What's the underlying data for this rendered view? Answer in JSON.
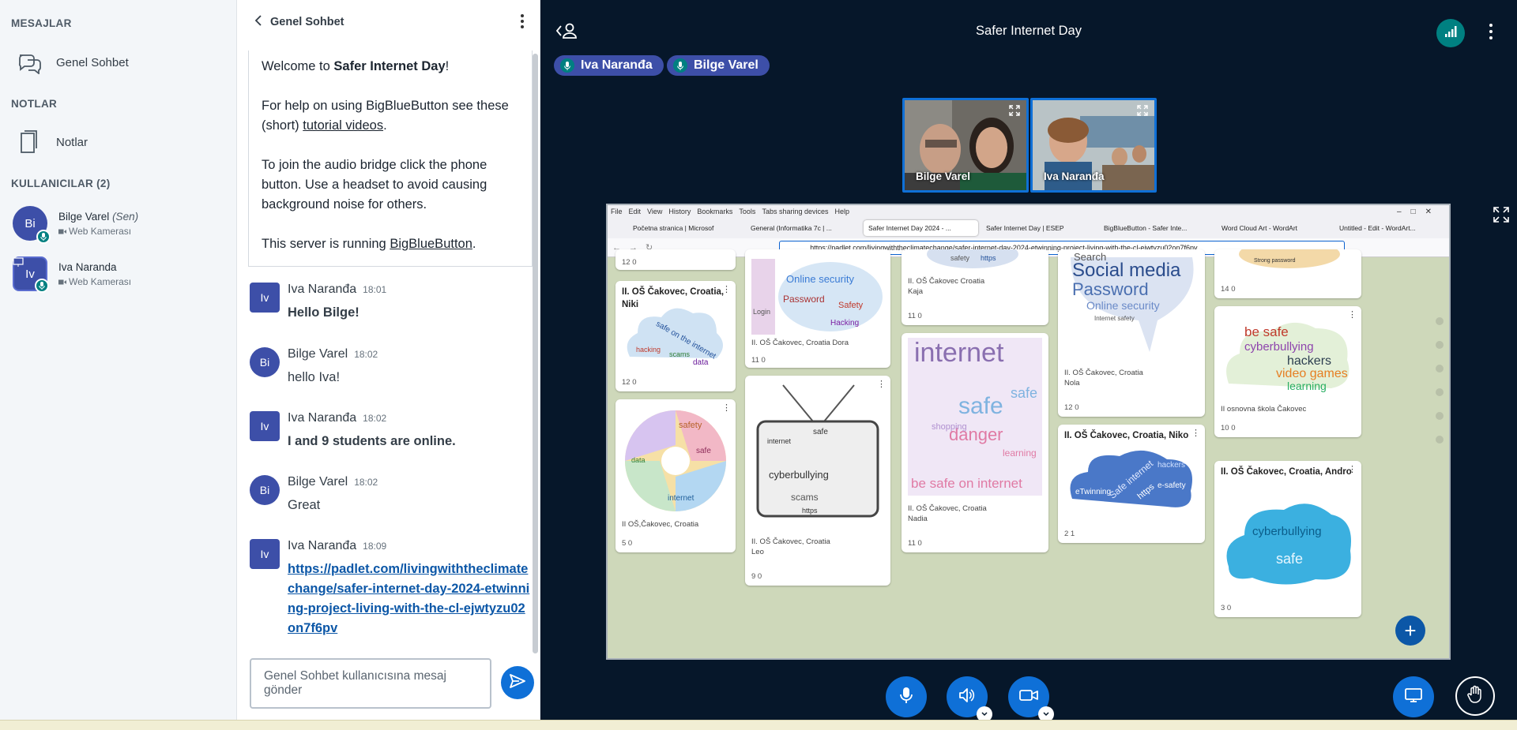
{
  "userlist": {
    "messages_title": "MESAJLAR",
    "public_chat": "Genel Sohbet",
    "notes_title": "NOTLAR",
    "notes_label": "Notlar",
    "users_title": "KULLANICILAR (2)",
    "users": [
      {
        "initials": "Bi",
        "name": "Bilge Varel",
        "you": "(Sen)",
        "sub": "Web Kamerası"
      },
      {
        "initials": "Iv",
        "name": "Iva Naranda",
        "you": "",
        "sub": "Web Kamerası"
      }
    ]
  },
  "chat": {
    "title": "Genel Sohbet",
    "welcome": {
      "line1_pre": "Welcome to ",
      "line1_bold": "Safer Internet Day",
      "line1_post": "!",
      "line2_pre": "For help on using BigBlueButton see these (short) ",
      "line2_link": "tutorial videos",
      "line2_post": ".",
      "line3": "To join the audio bridge click the phone button. Use a headset to avoid causing background noise for others.",
      "line4_pre": "This server is running ",
      "line4_link": "BigBlueButton",
      "line4_post": "."
    },
    "messages": [
      {
        "initials": "Iv",
        "name": "Iva Naranđa",
        "time": "18:01",
        "text": "Hello Bilge!"
      },
      {
        "initials": "Bi",
        "name": "Bilge Varel",
        "time": "18:02",
        "text": "hello Iva!"
      },
      {
        "initials": "Iv",
        "name": "Iva Naranđa",
        "time": "18:02",
        "text": "I and 9 students are online."
      },
      {
        "initials": "Bi",
        "name": "Bilge Varel",
        "time": "18:02",
        "text": "Great"
      },
      {
        "initials": "Iv",
        "name": "Iva Naranđa",
        "time": "18:09",
        "text": "https://padlet.com/livingwiththeclimatechange/safer-internet-day-2024-etwinning-project-living-with-the-cl-ejwtyzu02on7f6pv"
      }
    ],
    "composer_placeholder": "Genel Sohbet kullanıcısına mesaj gönder"
  },
  "main": {
    "title": "Safer Internet Day",
    "talkers": [
      "Iva Naranđa",
      "Bilge Varel"
    ],
    "cams": [
      "Bilge Varel",
      "Iva Naranđa"
    ]
  },
  "browser": {
    "menu": [
      "File",
      "Edit",
      "View",
      "History",
      "Bookmarks",
      "Tools",
      "Tabs sharing devices",
      "Help"
    ],
    "tabs": [
      "Početna stranica | Microsof",
      "General (Informatika 7c | ...",
      "Safer Internet Day 2024 - ...",
      "Safer Internet Day | ESEP",
      "BigBlueButton - Safer Inte...",
      "Word Cloud Art - WordArt",
      "Untitled - Edit - WordArt..."
    ],
    "url": "https://padlet.com/livingwiththeclimatechange/safer-internet-day-2024-etwinning-project-living-with-the-cl-ejwtyzu02on7f6pv"
  },
  "padlet": {
    "cards": [
      {
        "title": "II. OŠ Čakovec, Croatia, Niki",
        "sub": "",
        "stats": "12  0"
      },
      {
        "title": "",
        "sub": "II OŠ,Čakovec, Croatia",
        "stats": "5  0"
      },
      {
        "title": "",
        "sub": "II. OŠ Čakovec, Croatia Dora",
        "stats": "11  0"
      },
      {
        "title": "",
        "sub": "II. OŠ Čakovec, Croatia\nLeo",
        "stats": "9  0"
      },
      {
        "title": "",
        "sub": "II. OŠ Čakovec Croatia\nKaja",
        "stats": "11  0"
      },
      {
        "title": "",
        "sub": "II. OŠ Čakovec, Croatia\nNadia",
        "stats": "11  0"
      },
      {
        "title": "",
        "sub": "II. OŠ Čakovec, Croatia\nNola",
        "stats": "12  0"
      },
      {
        "title": "II. OŠ Čakovec, Croatia, Niko",
        "sub": "",
        "stats": "2  1"
      },
      {
        "title": "",
        "sub": "II osnovna škola Čakovec",
        "stats": "10  0"
      },
      {
        "title": "II. OŠ Čakovec, Croatia, Andro",
        "sub": "",
        "stats": "3  0"
      }
    ],
    "words": {
      "niki": [
        "safe on the internet",
        "hacking",
        "scams",
        "data"
      ],
      "dora": [
        "Online security",
        "Password",
        "Safety",
        "Login",
        "Hacking"
      ],
      "kaja": [
        "safety",
        "https"
      ],
      "nadia": [
        "internet",
        "safe",
        "danger",
        "learning",
        "safe",
        "be safe on internet",
        "shopping"
      ],
      "leo": [
        "safe",
        "internet",
        "cyberbullying",
        "scams",
        "https"
      ],
      "nola": [
        "Search",
        "Social media",
        "Password",
        "Online security",
        "Internet safety"
      ],
      "niko": [
        "eTwinning",
        "Safe internet",
        "https",
        "hackers",
        "e-safety"
      ],
      "c9": [
        "be safe",
        "cyberbullying",
        "hackers",
        "video games",
        "learning"
      ],
      "andro": [
        "cyberbullying",
        "safe"
      ],
      "swirl": [
        "safety",
        "safe",
        "internet",
        "data"
      ],
      "top": [
        "Strong password"
      ]
    },
    "top_stats": [
      "12  0",
      "14  0"
    ]
  }
}
